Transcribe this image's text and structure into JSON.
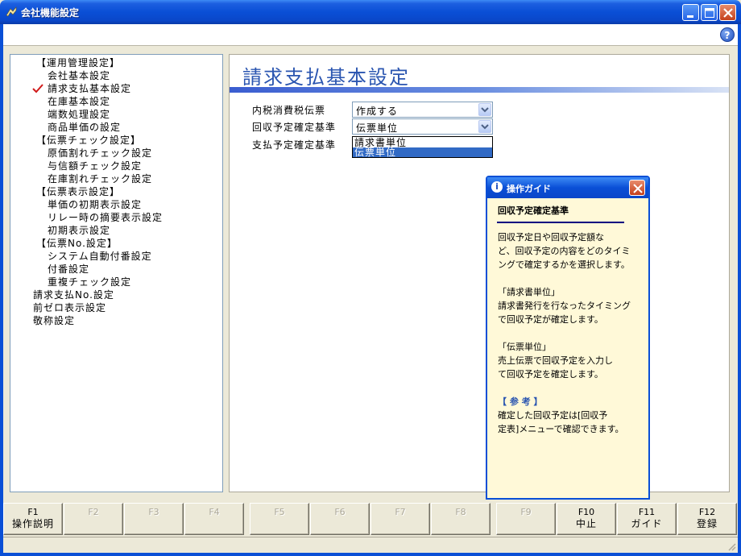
{
  "window": {
    "title": "会社機能設定",
    "help_icon": "?"
  },
  "tree": {
    "items": [
      {
        "label": "【運用管理設定】"
      },
      {
        "label": "会社基本設定"
      },
      {
        "label": "請求支払基本設定",
        "selected": true
      },
      {
        "label": "在庫基本設定"
      },
      {
        "label": "端数処理設定"
      },
      {
        "label": "商品単価の設定"
      },
      {
        "label": "【伝票チェック設定】"
      },
      {
        "label": "原価割れチェック設定"
      },
      {
        "label": "与信額チェック設定"
      },
      {
        "label": "在庫割れチェック設定"
      },
      {
        "label": "【伝票表示設定】"
      },
      {
        "label": "単価の初期表示設定"
      },
      {
        "label": "リレー時の摘要表示設定"
      },
      {
        "label": "初期表示設定"
      },
      {
        "label": "【伝票No.設定】"
      },
      {
        "label": "システム自動付番設定"
      },
      {
        "label": "付番設定"
      },
      {
        "label": "重複チェック設定"
      },
      {
        "label": "請求支払No.設定"
      },
      {
        "label": "前ゼロ表示設定"
      },
      {
        "label": "敬称設定"
      }
    ]
  },
  "content": {
    "title": "請求支払基本設定",
    "fields": [
      {
        "label": "内税消費税伝票",
        "value": "作成する"
      },
      {
        "label": "回収予定確定基準",
        "value": "伝票単位"
      },
      {
        "label": "支払予定確定基準",
        "value": ""
      }
    ],
    "dropdown_options": [
      "請求書単位",
      "伝票単位"
    ],
    "dropdown_selected": "伝票単位"
  },
  "guide": {
    "title": "操作ガイド",
    "subtitle": "回収予定確定基準",
    "lines": [
      "回収予定日や回収予定額な",
      "ど、回収予定の内容をどのタイミ",
      "ングで確定するかを選択します。",
      "",
      "「請求書単位」",
      "請求書発行を行なったタイミング",
      "で回収予定が確定します。",
      "",
      "「伝票単位」",
      "売上伝票で回収予定を入力し",
      "て回収予定を確定します。",
      "",
      "【 参 考 】",
      "確定した回収予定は[回収予",
      "定表]メニューで確認できます。"
    ]
  },
  "fkeys": [
    {
      "num": "F1",
      "label": "操作説明",
      "enabled": true
    },
    {
      "num": "F2",
      "label": "",
      "enabled": false
    },
    {
      "num": "F3",
      "label": "",
      "enabled": false
    },
    {
      "num": "F4",
      "label": "",
      "enabled": false
    },
    {
      "num": "F5",
      "label": "",
      "enabled": false
    },
    {
      "num": "F6",
      "label": "",
      "enabled": false
    },
    {
      "num": "F7",
      "label": "",
      "enabled": false
    },
    {
      "num": "F8",
      "label": "",
      "enabled": false
    },
    {
      "num": "F9",
      "label": "",
      "enabled": false
    },
    {
      "num": "F10",
      "label": "中止",
      "enabled": true
    },
    {
      "num": "F11",
      "label": "ガイド",
      "enabled": true
    },
    {
      "num": "F12",
      "label": "登録",
      "enabled": true
    }
  ],
  "colors": {
    "title_bar": "#0a4fd6",
    "accent": "#2a55b0",
    "guide_bg": "#fff9d8",
    "selection": "#316ac5",
    "check": "#d01a1a"
  }
}
